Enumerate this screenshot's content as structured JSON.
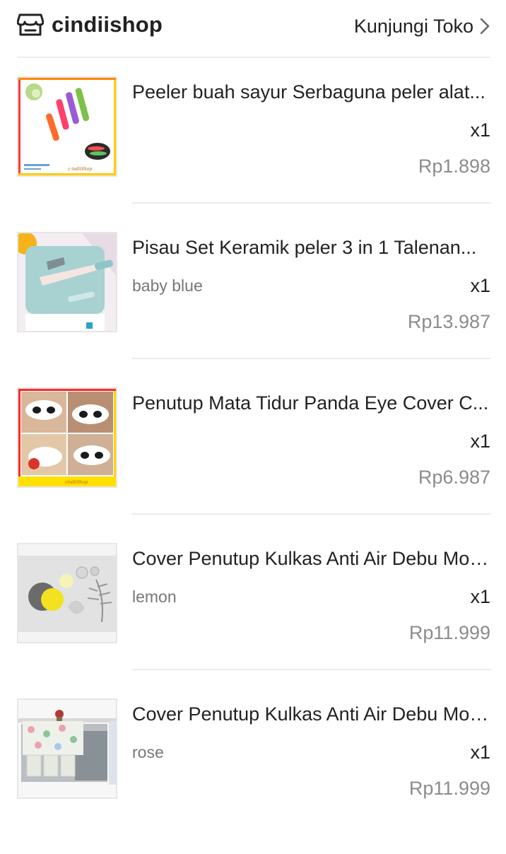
{
  "shop": {
    "name": "cindiishop",
    "icon": "store-icon",
    "visit_label": "Kunjungi Toko"
  },
  "items": [
    {
      "title": "Peeler buah sayur Serbaguna peler alat...",
      "variant": "",
      "qty": "x1",
      "price": "Rp1.898",
      "thumb_caption": "c·indiiShop"
    },
    {
      "title": "Pisau Set Keramik peler 3 in 1 Talenan...",
      "variant": "baby blue",
      "qty": "x1",
      "price": "Rp13.987"
    },
    {
      "title": "Penutup Mata Tidur Panda Eye Cover C...",
      "variant": "",
      "qty": "x1",
      "price": "Rp6.987",
      "thumb_caption": "cindiiShop"
    },
    {
      "title": "Cover Penutup Kulkas Anti Air Debu Mot...",
      "variant": "lemon",
      "qty": "x1",
      "price": "Rp11.999"
    },
    {
      "title": "Cover Penutup Kulkas Anti Air Debu Mot...",
      "variant": "rose",
      "qty": "x1",
      "price": "Rp11.999"
    }
  ],
  "colors": {
    "text": "#222222",
    "muted": "#777777",
    "price": "#8c8c8c",
    "divider": "#ececec"
  }
}
